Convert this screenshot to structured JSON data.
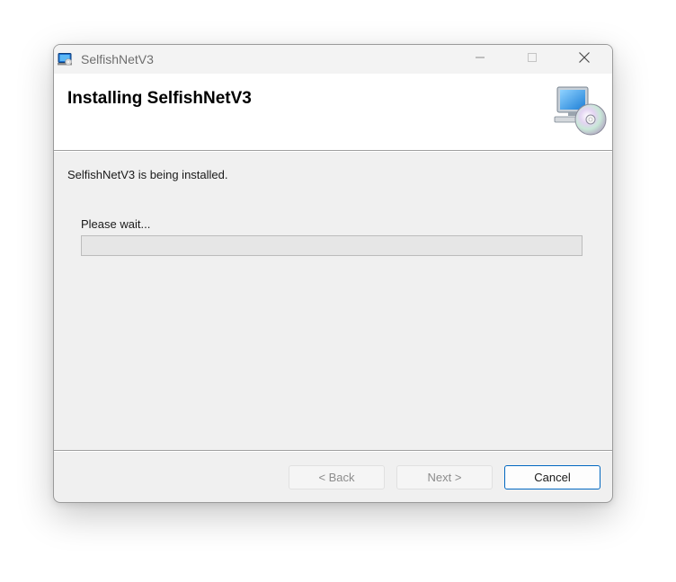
{
  "window": {
    "title": "SelfishNetV3",
    "app_icon": "installer-app-icon"
  },
  "caption_buttons": {
    "minimize_icon": "minimize-icon",
    "maximize_icon": "maximize-icon",
    "close_icon": "close-icon"
  },
  "header": {
    "title": "Installing SelfishNetV3",
    "icon": "computer-cd-icon"
  },
  "body": {
    "status": "SelfishNetV3 is being installed.",
    "wait_label": "Please wait...",
    "progress_percent": 0
  },
  "footer": {
    "back_label": "< Back",
    "next_label": "Next >",
    "cancel_label": "Cancel"
  },
  "colors": {
    "accent": "#0067c0",
    "progress_fill": "#06b025",
    "dialog_bg": "#f0f0f0"
  }
}
